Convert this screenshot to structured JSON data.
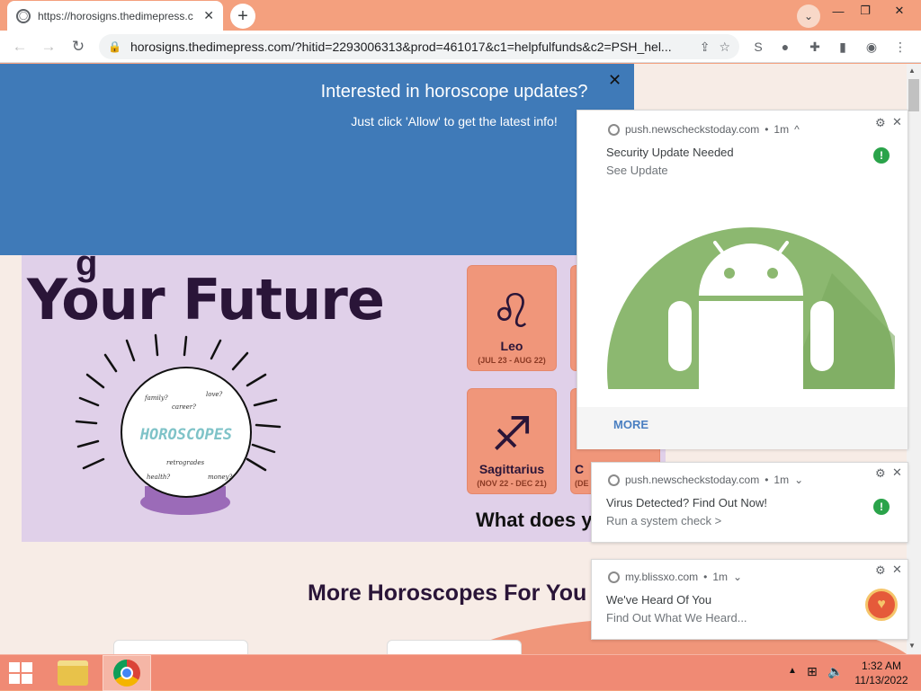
{
  "browser": {
    "tab_title": "https://horosigns.thedimepress.c",
    "tab_close": "✕",
    "new_tab": "+",
    "url": "horosigns.thedimepress.com/?hitid=2293006313&prod=461017&c1=helpfulfunds&c2=PSH_hel...",
    "window_controls": [
      "—",
      "❐",
      "✕"
    ]
  },
  "banner": {
    "heading": "Interested in horoscope updates?",
    "subtext": "Just click 'Allow' to get the latest info!",
    "close": "✕"
  },
  "hero": {
    "title": "Your Future",
    "crystal_ball_text": "HOROSCOPES",
    "crystal_ball_words": [
      "family?",
      "career?",
      "love?",
      "retrogrades",
      "health?",
      "money?"
    ],
    "question": "What does y",
    "cards": [
      {
        "name": "Leo",
        "dates": "(JUL 23 - AUG 22)",
        "symbol": "♌"
      },
      {
        "name": "Sagittarius",
        "dates": "(NOV 22 - DEC 21)",
        "symbol": "♐"
      }
    ],
    "partial_card_2": {
      "name": "C",
      "dates": "(DE"
    }
  },
  "more_heading": "More Horoscopes For You",
  "notifications": [
    {
      "source": "push.newscheckstoday.com",
      "time": "1m",
      "chevron": "^",
      "title": "Security Update Needed",
      "body": "See Update",
      "action": "MORE"
    },
    {
      "source": "push.newscheckstoday.com",
      "time": "1m",
      "chevron": "⌄",
      "title": "Virus Detected? Find Out Now!",
      "body": "Run a system check >"
    },
    {
      "source": "my.blissxo.com",
      "time": "1m",
      "chevron": "⌄",
      "title": "We've Heard Of You",
      "body": "Find Out What We Heard..."
    }
  ],
  "taskbar": {
    "time": "1:32 AM",
    "date": "11/13/2022"
  },
  "colors": {
    "chrome_frame": "#f4a07e",
    "banner": "#3f7ab8",
    "hero_bg": "#e0d0e9",
    "card": "#f0967a",
    "android_green": "#8cb870",
    "badge_green": "#2aa34a",
    "taskbar": "#f08a74"
  }
}
